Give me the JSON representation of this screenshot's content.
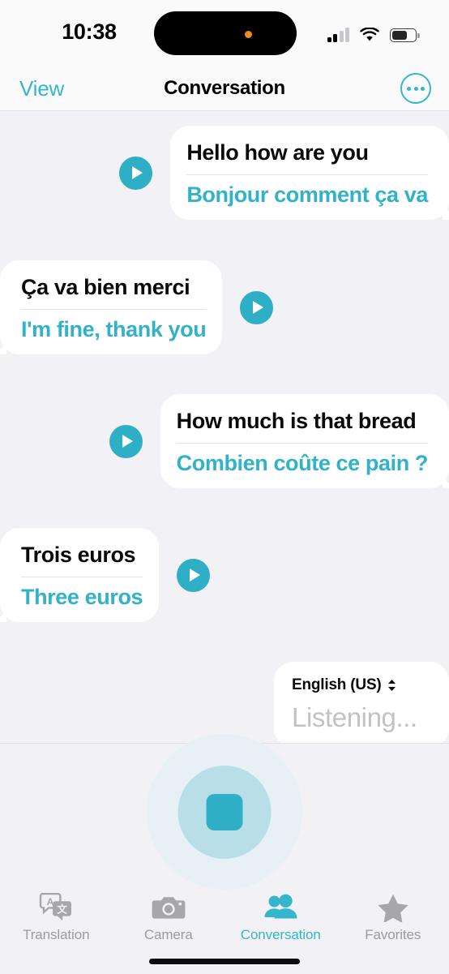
{
  "status_bar": {
    "time": "10:38",
    "signal_icon": "cellular-signal-icon",
    "signal_bars_active": 2,
    "wifi_icon": "wifi-icon",
    "battery_icon": "battery-icon",
    "battery_level_percent": 60,
    "dynamic_island_indicator": "microphone-in-use-dot"
  },
  "nav_bar": {
    "left_button": "View",
    "title": "Conversation",
    "more_button": "more-options"
  },
  "conversation": {
    "messages": [
      {
        "align": "right",
        "source_text": "Hello how are you",
        "translated_text": "Bonjour comment ça va",
        "play_button": "play-audio"
      },
      {
        "align": "left",
        "source_text": "Ça va bien merci",
        "translated_text": "I'm fine, thank you",
        "play_button": "play-audio"
      },
      {
        "align": "right",
        "source_text": "How much is that bread",
        "translated_text": "Combien coûte ce pain ?",
        "play_button": "play-audio"
      },
      {
        "align": "left",
        "source_text": "Trois euros",
        "translated_text": "Three euros",
        "play_button": "play-audio"
      }
    ],
    "listening_card": {
      "language": "English (US)",
      "status_text": "Listening..."
    }
  },
  "record_control": {
    "state_icon": "stop-square",
    "action": "stop-listening"
  },
  "tab_bar": {
    "tabs": [
      {
        "label": "Translation",
        "icon": "translation-bubbles-icon",
        "active": false
      },
      {
        "label": "Camera",
        "icon": "camera-icon",
        "active": false
      },
      {
        "label": "Conversation",
        "icon": "two-people-icon",
        "active": true
      },
      {
        "label": "Favorites",
        "icon": "star-icon",
        "active": false
      }
    ]
  },
  "colors": {
    "accent_teal": "#35B6CC",
    "play_teal": "#2FAFC6",
    "background": "#F2F1F6",
    "bubble": "#FFFFFF",
    "inactive_tab": "#9A9A9F",
    "placeholder_grey": "#C2C2C6"
  }
}
